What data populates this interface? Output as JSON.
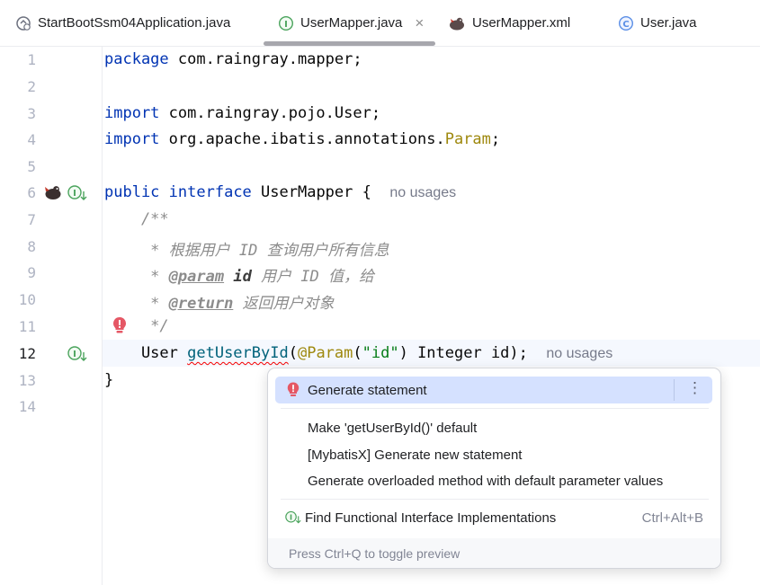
{
  "tabs": [
    {
      "label": "StartBootSsm04Application.java",
      "icon": "spring-boot-icon"
    },
    {
      "label": "UserMapper.java",
      "icon": "interface-icon",
      "active": true
    },
    {
      "label": "UserMapper.xml",
      "icon": "mybatis-bird-icon"
    },
    {
      "label": "User.java",
      "icon": "class-icon"
    }
  ],
  "gutter": {
    "lines": [
      "1",
      "2",
      "3",
      "4",
      "5",
      "6",
      "7",
      "8",
      "9",
      "10",
      "11",
      "12",
      "13",
      "14"
    ],
    "current_line": "12"
  },
  "code": {
    "l1": {
      "kw": "package",
      "rest": " com.raingray.mapper;"
    },
    "l3": {
      "kw": "import",
      "rest": " com.raingray.pojo.User;"
    },
    "l4": {
      "kw": "import",
      "rest": " org.apache.ibatis.annotations.",
      "ann": "Param",
      "end": ";"
    },
    "l6": {
      "kw1": "public",
      "kw2": "interface",
      "rest": " UserMapper {",
      "hint": "no usages"
    },
    "l7": "    /**",
    "l8": "     * 根据用户 ID 查询用户所有信息",
    "l9": {
      "pre": "     * ",
      "tag": "@param",
      "name": "id",
      "text": " 用户 ID 值，给"
    },
    "l10": {
      "pre": "     * ",
      "tag": "@return",
      "text": " 返回用户对象"
    },
    "l11": "     */",
    "l12": {
      "indent": "    User ",
      "method": "getUserById",
      "p1": "(",
      "ann": "@Param",
      "p2": "(",
      "str": "\"id\"",
      "rest": ") Integer id);",
      "hint": "no usages"
    },
    "l13": "}"
  },
  "popup": {
    "items": [
      {
        "label": "Generate statement"
      },
      {
        "label": "Make 'getUserById()' default"
      },
      {
        "label": "[MybatisX] Generate new statement"
      },
      {
        "label": "Generate overloaded method with default parameter values"
      }
    ],
    "find_impl": {
      "label": "Find Functional Interface Implementations",
      "shortcut": "Ctrl+Alt+B"
    },
    "footer": "Press Ctrl+Q to toggle preview",
    "more_icon": "more-vertical-icon"
  },
  "colors": {
    "accent_error": "#e55765",
    "implement_icon": "#4aa35c",
    "keyword": "#0033b3"
  }
}
